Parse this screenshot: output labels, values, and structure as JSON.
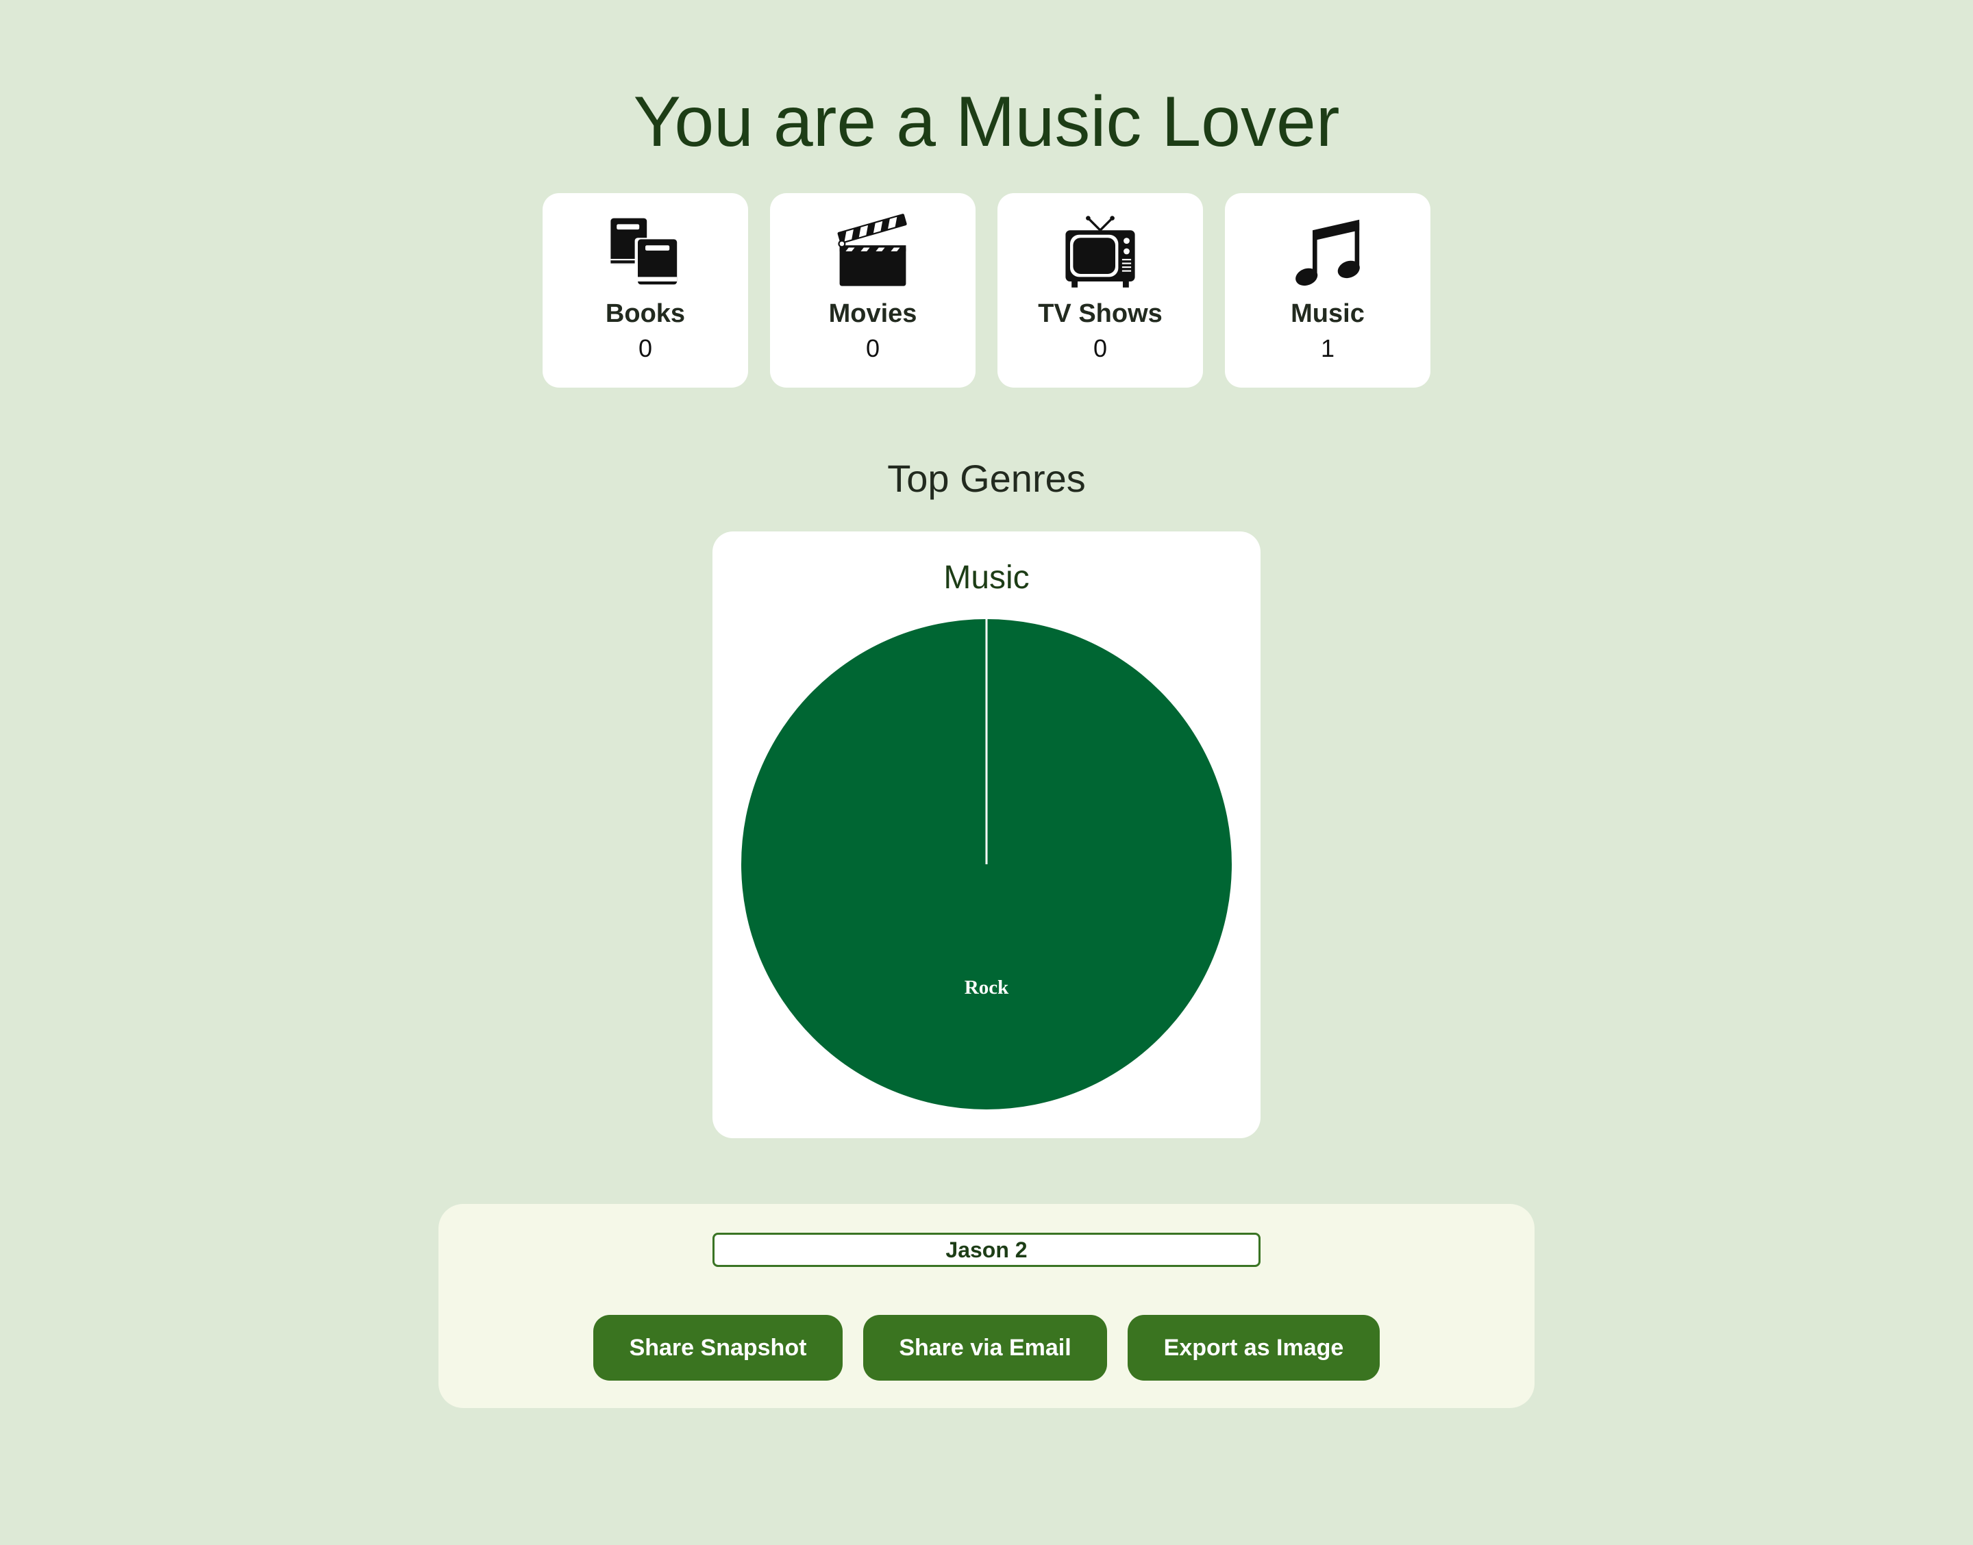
{
  "header": {
    "title": "You are a Music Lover"
  },
  "stats": [
    {
      "label": "Books",
      "count": "0",
      "icon": "books-icon"
    },
    {
      "label": "Movies",
      "count": "0",
      "icon": "clapperboard-icon"
    },
    {
      "label": "TV Shows",
      "count": "0",
      "icon": "television-icon"
    },
    {
      "label": "Music",
      "count": "1",
      "icon": "music-note-icon"
    }
  ],
  "genres_section": {
    "title": "Top Genres"
  },
  "chart_data": {
    "type": "pie",
    "title": "Music",
    "categories": [
      "Rock"
    ],
    "values": [
      1
    ],
    "colors": [
      "#006633"
    ]
  },
  "share": {
    "name_value": "Jason 2",
    "buttons": {
      "snapshot": "Share Snapshot",
      "email": "Share via Email",
      "export": "Export as Image"
    },
    "button_color": "#3a7420"
  },
  "colors": {
    "background": "#dde9d6",
    "title": "#1d3d16",
    "panel": "#f5f8e8"
  }
}
